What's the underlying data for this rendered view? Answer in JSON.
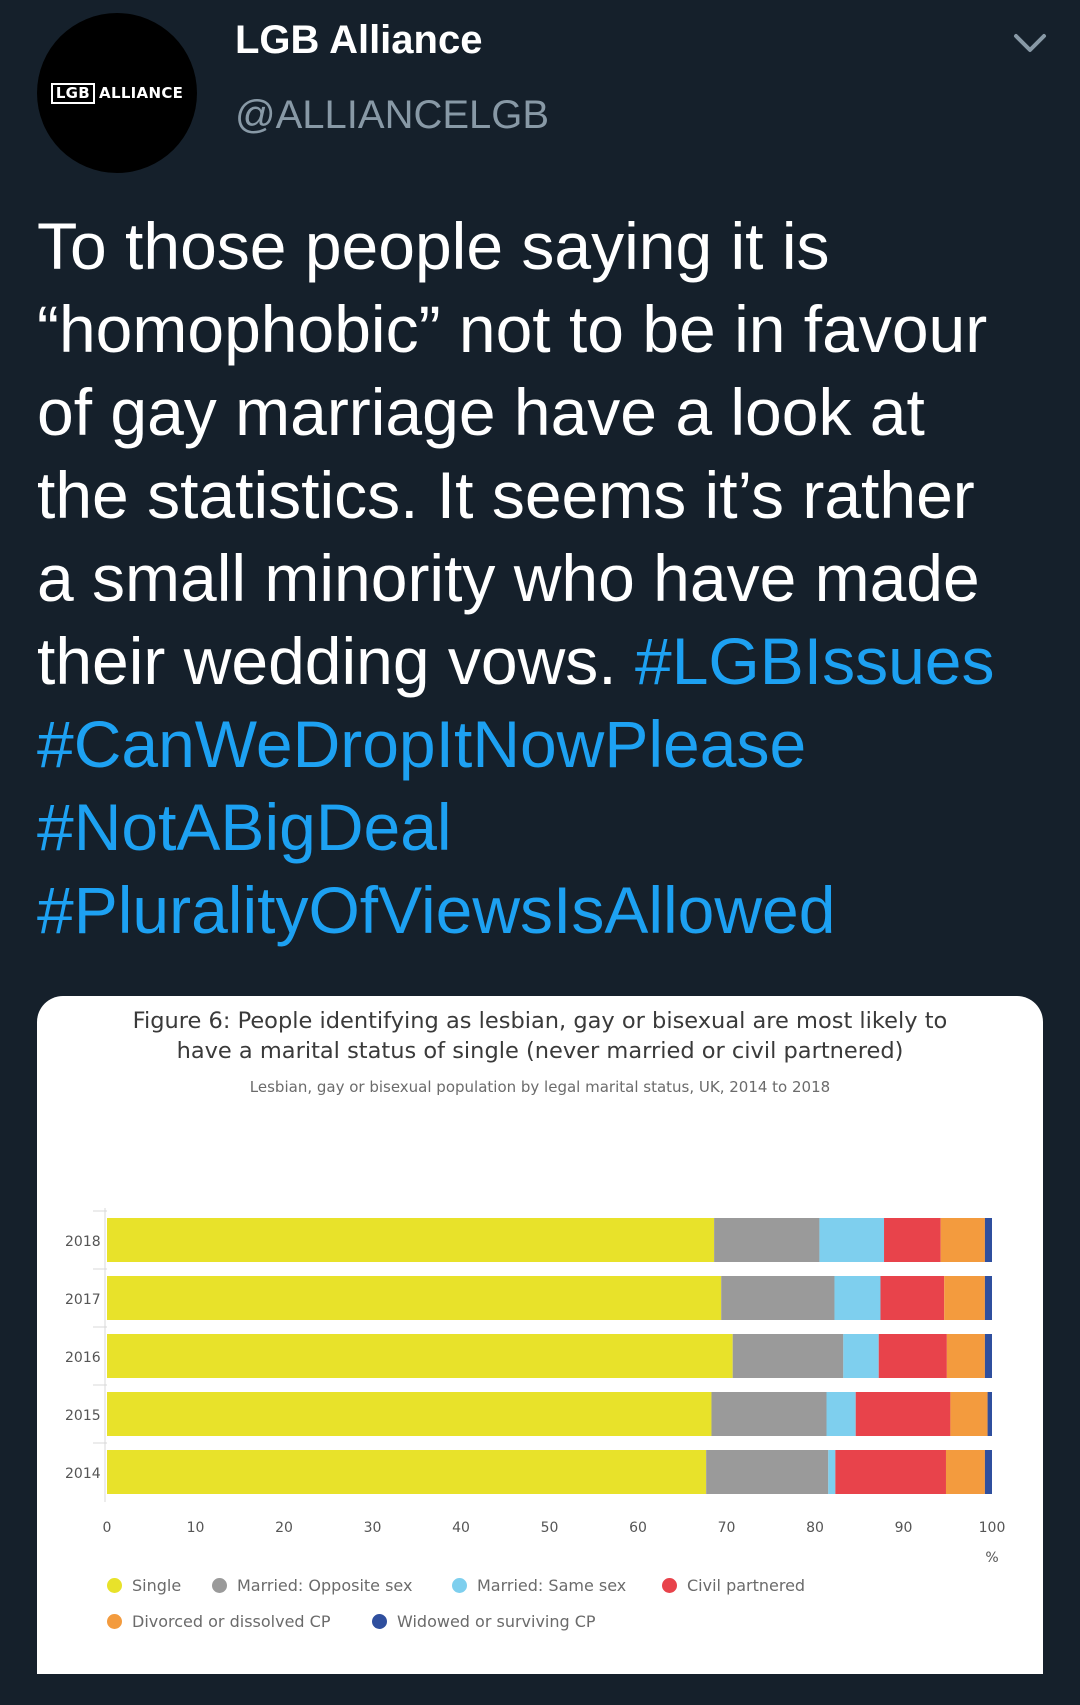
{
  "tweet": {
    "display_name": "LGB Alliance",
    "handle": "@ALLIANCELGB",
    "avatar_logo": {
      "boxed": "LGB",
      "text": "ALLIANCE"
    },
    "lines": [
      "To those people saying it is",
      "“homophobic” not to be in favour",
      "of gay marriage have a look at",
      "the statistics. It seems it’s rather",
      "a small minority who have made",
      "their wedding vows."
    ],
    "hashtags": [
      "#LGBIssues",
      "#CanWeDropItNowPlease",
      "#NotABigDeal",
      "#PluralityOfViewsIsAllowed"
    ],
    "menu_icon": "chevron-down-icon",
    "colors": {
      "background": "#15202b",
      "text": "#ffffff",
      "handle": "#8899a6",
      "hashtag": "#1da1f2"
    }
  },
  "figure": {
    "title_line1": "Figure 6: People identifying as lesbian, gay or bisexual are most likely to",
    "title_line2": "have a marital status of single (never married or civil partnered)",
    "subtitle": "Lesbian, gay or bisexual population by legal marital status, UK, 2014 to 2018"
  },
  "chart_data": {
    "type": "bar",
    "orientation": "horizontal",
    "stacked": true,
    "categories": [
      "2018",
      "2017",
      "2016",
      "2015",
      "2014"
    ],
    "series": [
      {
        "name": "Single",
        "color": "#e8e22a",
        "values": [
          68.6,
          69.4,
          70.7,
          68.3,
          67.7
        ]
      },
      {
        "name": "Married: Opposite sex",
        "color": "#9a9a9a",
        "values": [
          11.9,
          12.8,
          12.5,
          13.0,
          13.8
        ]
      },
      {
        "name": "Married: Same sex",
        "color": "#7ecfee",
        "values": [
          7.3,
          5.2,
          4.0,
          3.3,
          0.8
        ]
      },
      {
        "name": "Civil partnered",
        "color": "#e8434b",
        "values": [
          6.4,
          7.2,
          7.7,
          10.7,
          12.5
        ]
      },
      {
        "name": "Divorced or dissolved CP",
        "color": "#f39b3e",
        "values": [
          5.0,
          4.6,
          4.3,
          4.2,
          4.4
        ]
      },
      {
        "name": "Widowed or surviving CP",
        "color": "#2f4f9e",
        "values": [
          0.8,
          0.8,
          0.8,
          0.5,
          0.8
        ]
      }
    ],
    "xlim": [
      0,
      100
    ],
    "xticks": [
      "0",
      "10",
      "20",
      "30",
      "40",
      "50",
      "60",
      "70",
      "80",
      "90",
      "100"
    ],
    "x_unit": "%",
    "legend_position": "bottom",
    "grid": false
  }
}
